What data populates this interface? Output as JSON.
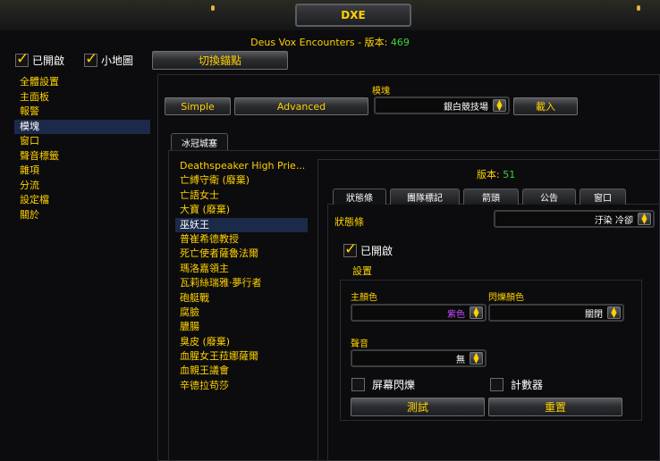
{
  "window": {
    "title": "DXE"
  },
  "header": {
    "app_name": "Deus Vox Encounters",
    "version_label": " - 版本: ",
    "version": "469"
  },
  "top": {
    "enabled_label": "已開啟",
    "minimap_label": "小地圖",
    "toggle_anchor_label": "切換錨點"
  },
  "sidebar": {
    "items": [
      {
        "label": "全體設置"
      },
      {
        "label": "主面板"
      },
      {
        "label": "報警"
      },
      {
        "label": "模塊"
      },
      {
        "label": "窗口"
      },
      {
        "label": "聲音標籤"
      },
      {
        "label": "雜項"
      },
      {
        "label": "分流"
      },
      {
        "label": "設定檔"
      },
      {
        "label": "關於"
      }
    ],
    "active_index": 3
  },
  "module": {
    "section_label": "模塊",
    "simple_label": "Simple",
    "advanced_label": "Advanced",
    "zone_selected": "銀白競技場",
    "load_label": "載入",
    "zone_tab": "冰冠城塞"
  },
  "encounters": {
    "items": [
      {
        "label": "Deathspeaker High Prie..."
      },
      {
        "label": "亡縛守衛 (廢棄)"
      },
      {
        "label": "亡語女士"
      },
      {
        "label": "大寶 (廢棄)"
      },
      {
        "label": "巫妖王"
      },
      {
        "label": "普崔希德教授"
      },
      {
        "label": "死亡使者薩魯法爾"
      },
      {
        "label": "瑪洛嘉領主"
      },
      {
        "label": "瓦莉絲瑞雅·夢行者"
      },
      {
        "label": "砲艇戰"
      },
      {
        "label": "腐臉"
      },
      {
        "label": "膿腸"
      },
      {
        "label": "臭皮 (廢棄)"
      },
      {
        "label": "血腥女王菈娜薩爾"
      },
      {
        "label": "血親王議會"
      },
      {
        "label": "辛德拉苟莎"
      }
    ],
    "active_index": 4
  },
  "detail": {
    "version_label": "版本: ",
    "version": "51",
    "tabs": [
      {
        "label": "狀態條"
      },
      {
        "label": "團隊標記"
      },
      {
        "label": "箭頭"
      },
      {
        "label": "公告"
      },
      {
        "label": "窗口"
      }
    ],
    "active_tab": 0,
    "bar_label": "狀態條",
    "bar_selected": "汙染 冷卻",
    "enabled_label": "已開啟",
    "settings_label": "設置",
    "main_color_label": "主顏色",
    "main_color_value": "紫色",
    "flash_color_label": "閃爍顏色",
    "flash_color_value": "關閉",
    "sound_label": "聲音",
    "sound_value": "無",
    "screen_flash_label": "屏幕閃爍",
    "counter_label": "計數器",
    "test_label": "測試",
    "reset_label": "重置"
  },
  "colors": {
    "gold": "#ffd200",
    "green": "#3cd23c",
    "purple": "#c34cff",
    "selection": "#1c2a4a"
  }
}
